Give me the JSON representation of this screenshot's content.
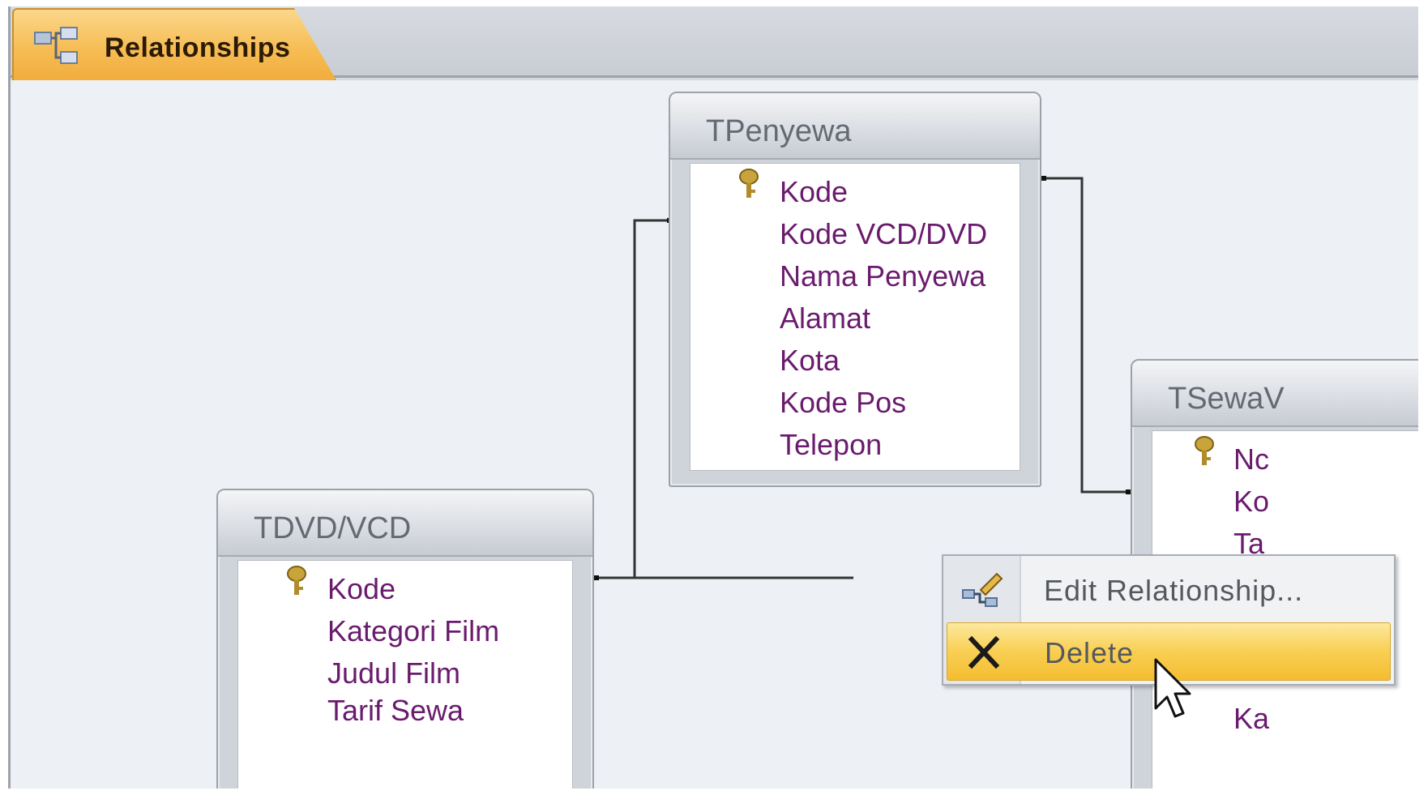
{
  "tab": {
    "label": "Relationships",
    "icon": "relationships-icon"
  },
  "tables": [
    {
      "id": "tpenyewa",
      "title": "TPenyewa",
      "fields": [
        {
          "name": "Kode",
          "primary_key": true
        },
        {
          "name": "Kode VCD/DVD",
          "primary_key": false
        },
        {
          "name": "Nama Penyewa",
          "primary_key": false
        },
        {
          "name": "Alamat",
          "primary_key": false
        },
        {
          "name": "Kota",
          "primary_key": false
        },
        {
          "name": "Kode Pos",
          "primary_key": false
        },
        {
          "name": "Telepon",
          "primary_key": false
        }
      ]
    },
    {
      "id": "tdvdvcd",
      "title": "TDVD/VCD",
      "fields": [
        {
          "name": "Kode",
          "primary_key": true
        },
        {
          "name": "Kategori Film",
          "primary_key": false
        },
        {
          "name": "Judul Film",
          "primary_key": false
        },
        {
          "name": "Tarif Sewa",
          "primary_key": false
        }
      ]
    },
    {
      "id": "tsewa",
      "title": "TSewaV",
      "fields": [
        {
          "name": "Nc",
          "primary_key": true
        },
        {
          "name": "Ko",
          "primary_key": false
        },
        {
          "name": "Ta",
          "primary_key": false
        },
        {
          "name": "Ka",
          "primary_key": false
        }
      ]
    }
  ],
  "context_menu": {
    "items": [
      {
        "label": "Edit Relationship...",
        "icon": "edit-relationship-icon",
        "highlighted": false
      },
      {
        "label": "Delete",
        "icon": "delete-x-icon",
        "highlighted": true
      }
    ]
  },
  "colors": {
    "tab_accent": "#f6bd55",
    "field_text": "#6a1b6e",
    "menu_highlight": "#f9cf53"
  }
}
